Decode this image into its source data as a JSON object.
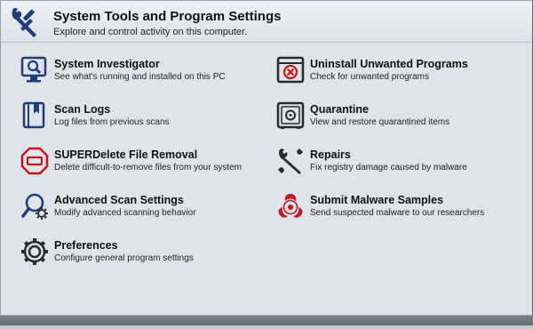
{
  "header": {
    "title": "System Tools and Program Settings",
    "subtitle": "Explore and control activity on this computer."
  },
  "items": [
    {
      "icon": "magnifier-monitor-icon",
      "name": "System Investigator",
      "desc": "See what's running and installed on this PC",
      "color": "#1f3d7a"
    },
    {
      "icon": "uninstall-icon",
      "name": "Uninstall Unwanted Programs",
      "desc": "Check for unwanted programs",
      "color": "#c0181c"
    },
    {
      "icon": "book-icon",
      "name": "Scan Logs",
      "desc": "Log files from previous scans",
      "color": "#1f3d7a"
    },
    {
      "icon": "safe-icon",
      "name": "Quarantine",
      "desc": "View and restore quarantined items",
      "color": "#2a2a2a"
    },
    {
      "icon": "stop-sign-icon",
      "name": "SUPERDelete File Removal",
      "desc": "Delete difficult-to-remove files from your system",
      "color": "#c0181c"
    },
    {
      "icon": "wrench-screwdriver-icon",
      "name": "Repairs",
      "desc": "Fix registry damage caused by malware",
      "color": "#2a2a2a"
    },
    {
      "icon": "magnifier-gear-icon",
      "name": "Advanced Scan Settings",
      "desc": "Modify advanced scanning behavior",
      "color": "#1f3d7a"
    },
    {
      "icon": "biohazard-icon",
      "name": "Submit Malware Samples",
      "desc": "Send suspected malware to our researchers",
      "color": "#c0181c"
    },
    {
      "icon": "gear-icon",
      "name": "Preferences",
      "desc": "Configure general program settings",
      "color": "#2a2a2a"
    }
  ]
}
